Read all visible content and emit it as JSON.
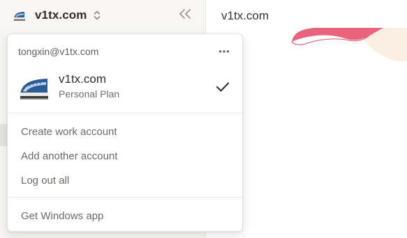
{
  "sidebar": {
    "workspace_name": "v1tx.com",
    "workspace_icon": "train-icon",
    "collapse_icon": "double-chevron-left-icon",
    "switcher_icon": "chevron-up-down-icon"
  },
  "main": {
    "title": "v1tx.com"
  },
  "menu": {
    "email": "tongxin@v1tx.com",
    "more_icon": "more-horizontal-icon",
    "account": {
      "name": "v1tx.com",
      "plan": "Personal Plan",
      "selected_icon": "check-icon"
    },
    "actions": [
      {
        "label": "Create work account"
      },
      {
        "label": "Add another account"
      },
      {
        "label": "Log out all"
      }
    ],
    "footer_action": {
      "label": "Get Windows app"
    }
  },
  "colors": {
    "sidebar_bg": "#f7f6f3",
    "text_primary": "#37352f",
    "text_secondary": "#6b6a66",
    "cover_pink": "#e9637a",
    "cover_skin": "#fbeee2"
  }
}
